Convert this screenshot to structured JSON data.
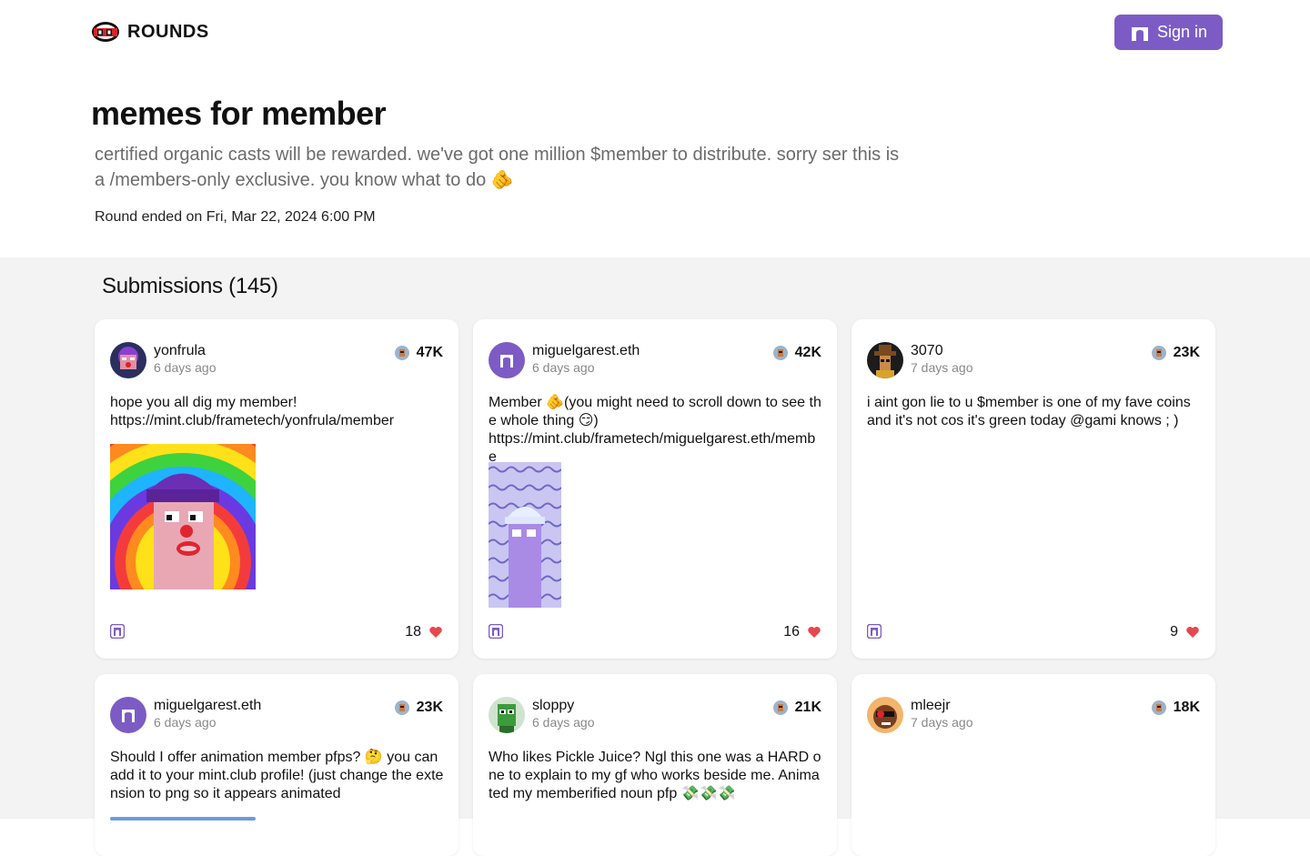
{
  "header": {
    "brand": "ROUNDS",
    "sign_in_label": "Sign in"
  },
  "round": {
    "title": "memes for member",
    "description": "certified organic casts will be rewarded. we've got one million $member to distribute. sorry ser this is a /members-only exclusive. you know what to do 🫵",
    "ended": "Round ended on Fri, Mar 22, 2024 6:00 PM"
  },
  "submissions": {
    "heading": "Submissions (145)",
    "cards": [
      {
        "username": "yonfrula",
        "time_ago": "6 days ago",
        "score": "47K",
        "text": "hope you all dig my member!\nhttps://mint.club/frametech/yonfrula/member",
        "likes": "18"
      },
      {
        "username": "miguelgarest.eth",
        "time_ago": "6 days ago",
        "score": "42K",
        "text": "Member 🫵(you might need to scroll down to see the whole thing 😏)\nhttps://mint.club/frametech/miguelgarest.eth/membe",
        "likes": "16"
      },
      {
        "username": "3070",
        "time_ago": "7 days ago",
        "score": "23K",
        "text": "i aint gon lie to u $member is one of my fave coins and it's not cos it's green today @gami knows ; )",
        "likes": "9"
      },
      {
        "username": "miguelgarest.eth",
        "time_ago": "6 days ago",
        "score": "23K",
        "text": "Should I offer animation member pfps? 🤔 you can add it to your mint.club profile! (just change the extension to png so it appears animated",
        "likes": ""
      },
      {
        "username": "sloppy",
        "time_ago": "6 days ago",
        "score": "21K",
        "text": "Who likes Pickle Juice? Ngl this one was a HARD one to explain to my gf who works beside me. Animated my memberified noun pfp 💸💸💸",
        "likes": ""
      },
      {
        "username": "mleejr",
        "time_ago": "7 days ago",
        "score": "18K",
        "text": "",
        "likes": ""
      }
    ]
  },
  "colors": {
    "accent": "#7c5cc4",
    "heart": "#e5484d",
    "section_bg": "#f3f3f3"
  },
  "icons": [
    "rounds-logo-icon",
    "arch-icon",
    "member-coin-icon",
    "heart-icon"
  ]
}
